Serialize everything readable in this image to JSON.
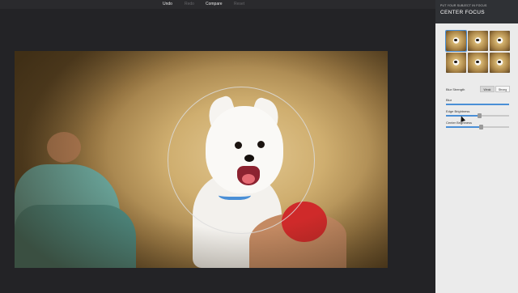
{
  "toolbar": {
    "undo": "Undo",
    "redo": "Redo",
    "compare": "Compare",
    "reset": "Reset"
  },
  "panel": {
    "subtitle": "PUT YOUR SUBJECT IN FOCUS",
    "title": "CENTER FOCUS",
    "presets": [
      "preset-1",
      "preset-2",
      "preset-3",
      "preset-4",
      "preset-5",
      "preset-6"
    ],
    "blur_strength": {
      "label": "Blur Strength",
      "options": [
        "Weak",
        "Strong"
      ],
      "selected": "Weak"
    },
    "sliders": {
      "blur": {
        "label": "Blur",
        "value": 1.0
      },
      "edge_brightness": {
        "label": "Edge Brightness",
        "value": 0.52
      },
      "center_brightness": {
        "label": "Center Brightness",
        "value": 0.55
      }
    }
  },
  "colors": {
    "accent": "#4a8fd6",
    "panel_header": "#2f3135",
    "toolbar": "#2a2a2d"
  }
}
